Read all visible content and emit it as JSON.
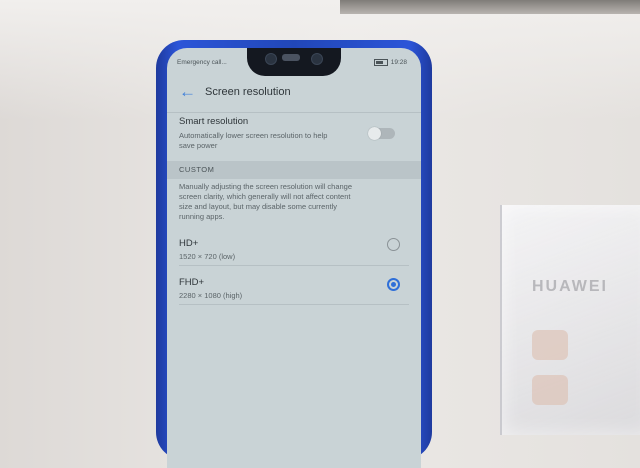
{
  "status_bar": {
    "left_text": "Emergency call...",
    "time": "19:28"
  },
  "header": {
    "back_icon": "arrow-left-icon",
    "title": "Screen resolution"
  },
  "smart_resolution": {
    "label": "Smart resolution",
    "description_line1": "Automatically lower screen resolution to help",
    "description_line2": "save power",
    "enabled": false
  },
  "custom_section": {
    "header": "CUSTOM",
    "description_lines": [
      "Manually adjusting the screen resolution will change",
      "screen clarity, which generally will not affect content",
      "size and layout, but may disable some currently",
      "running apps."
    ]
  },
  "options": [
    {
      "label": "HD+",
      "detail": "1520 × 720 (low)",
      "selected": false
    },
    {
      "label": "FHD+",
      "detail": "2280 × 1080 (high)",
      "selected": true
    }
  ],
  "background": {
    "box_brand": "HUAWEI"
  },
  "colors": {
    "accent": "#2f6fd8",
    "phone_body": "#2147b8",
    "screen_bg": "#c9d3d6"
  }
}
